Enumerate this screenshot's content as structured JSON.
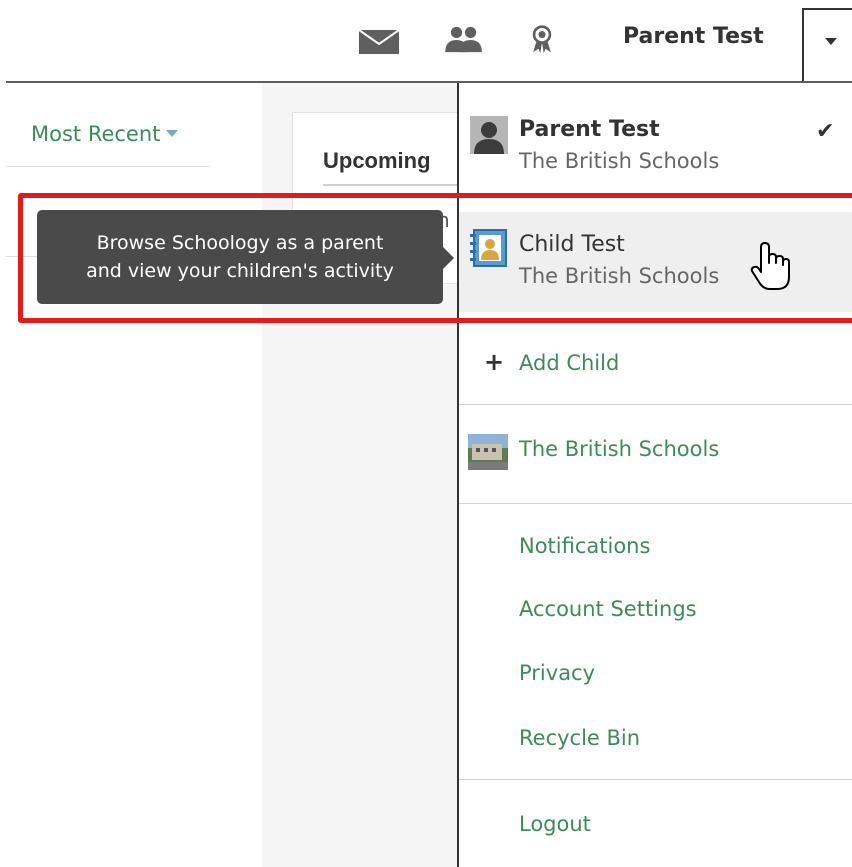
{
  "header": {
    "user_name": "Parent Test",
    "icons": [
      "envelope-icon",
      "people-icon",
      "badge-icon"
    ]
  },
  "left": {
    "most_recent_label": "Most Recent",
    "upcoming_title": "Upcoming",
    "peek_text": "n"
  },
  "tooltip": {
    "line1": "Browse Schoology as a parent",
    "line2": "and view your children's activity"
  },
  "menu": {
    "current_account": {
      "name": "Parent Test",
      "school": "The British Schools",
      "check": "✔"
    },
    "child_account": {
      "name": "Child Test",
      "school": "The British Schools"
    },
    "add_child": {
      "plus": "+",
      "label": "Add Child"
    },
    "school_link": "The British Schools",
    "links": [
      "Notifications",
      "Account Settings",
      "Privacy",
      "Recycle Bin"
    ],
    "logout": "Logout"
  },
  "colors": {
    "accent_green": "#3f8a5c",
    "highlight_red": "#e01c1c",
    "tooltip_bg": "#4a4a4a"
  }
}
